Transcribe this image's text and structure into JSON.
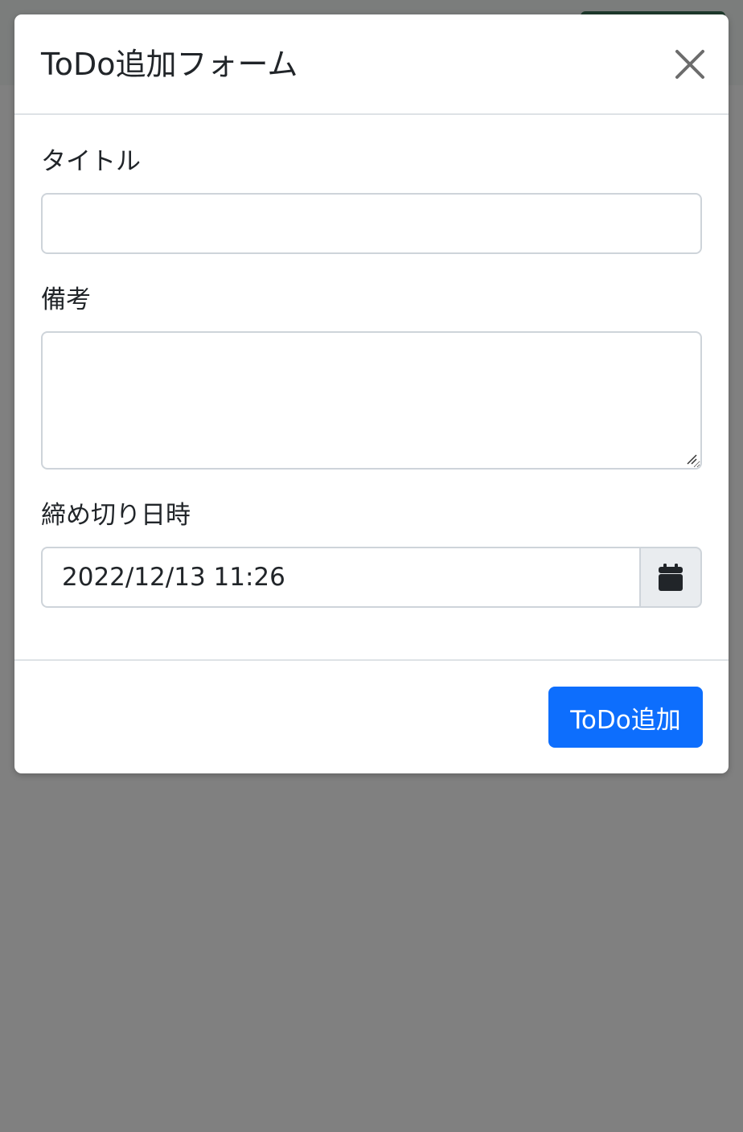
{
  "modal": {
    "title": "ToDo追加フォーム",
    "close_icon": "close-icon"
  },
  "form": {
    "title_label": "タイトル",
    "title_value": "",
    "notes_label": "備考",
    "notes_value": "",
    "deadline_label": "締め切り日時",
    "deadline_value": "2022/12/13 11:26",
    "calendar_icon": "calendar-icon"
  },
  "footer": {
    "submit_label": "ToDo追加"
  },
  "colors": {
    "primary": "#0d6efd",
    "overlay": "#808080",
    "addon_bg": "#e9ecef",
    "border": "#ced4da"
  }
}
